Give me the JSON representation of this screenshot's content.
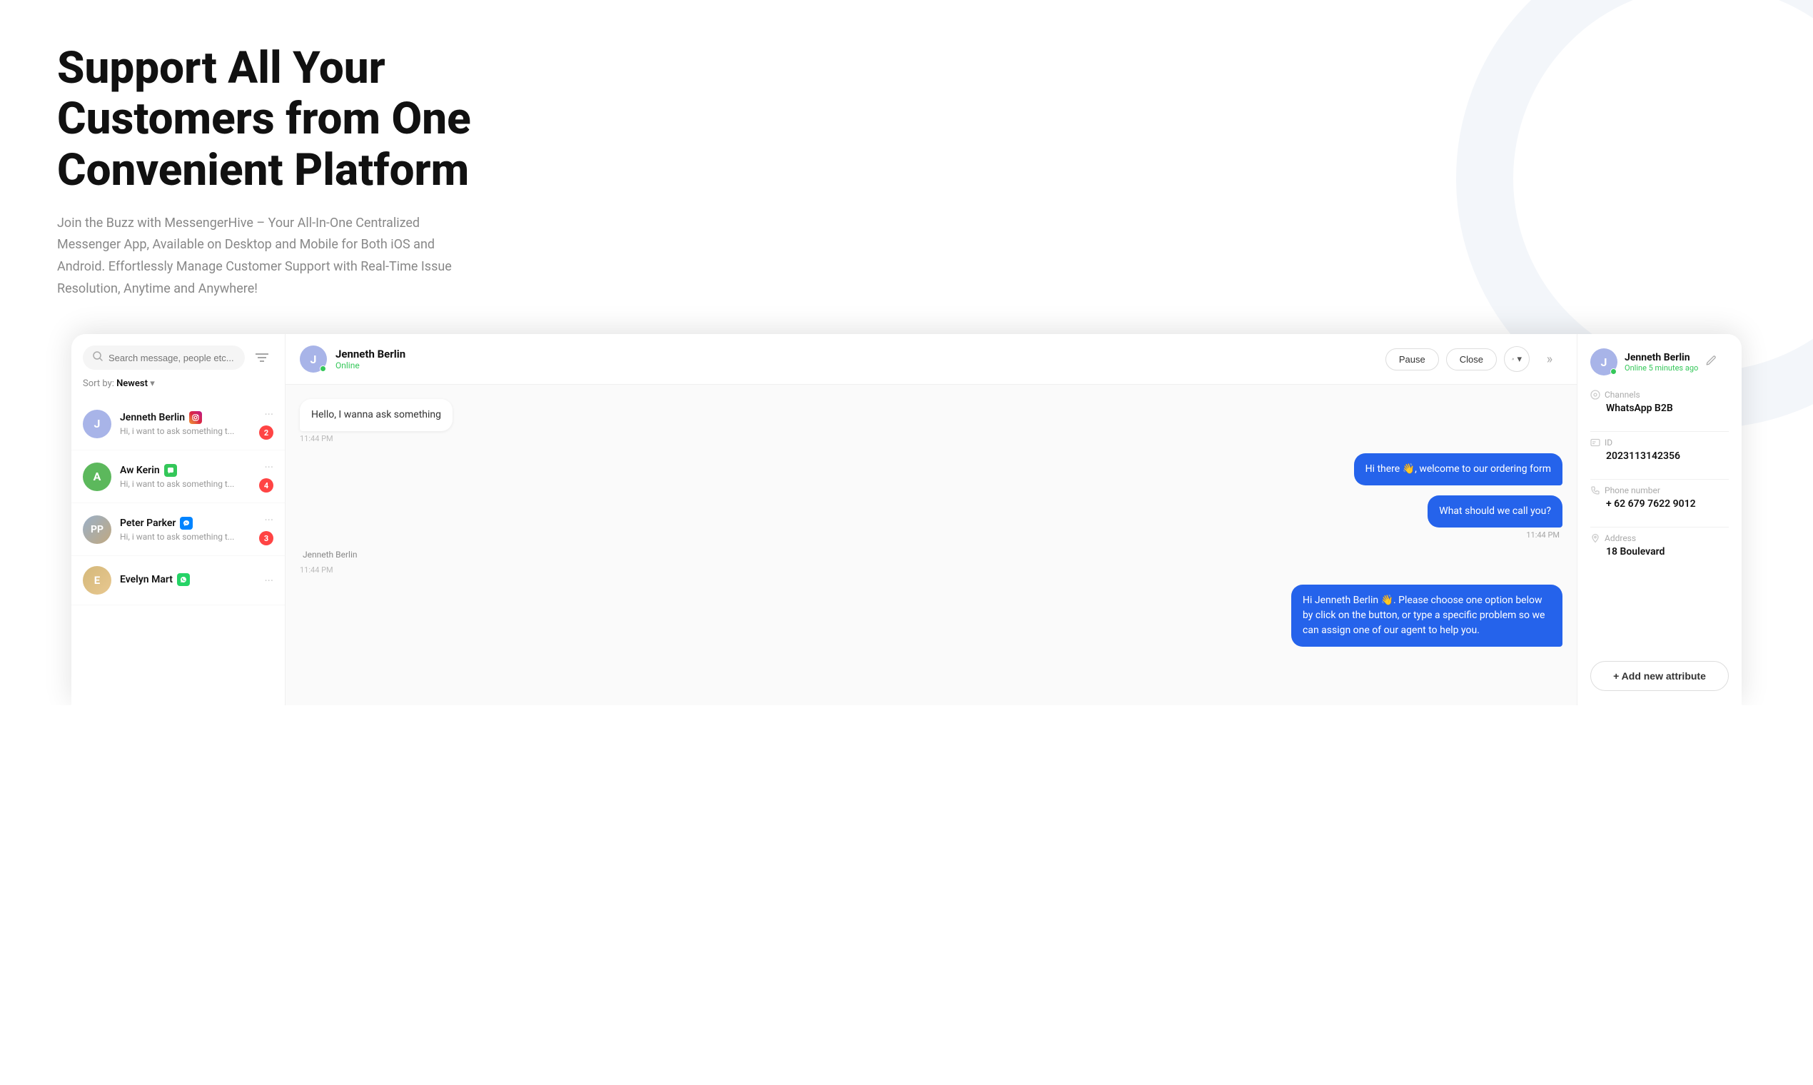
{
  "hero": {
    "title": "Support All Your Customers from One Convenient Platform",
    "subtitle": "Join the Buzz with MessengerHive – Your All-In-One Centralized Messenger App, Available on Desktop and Mobile for Both iOS and Android. Effortlessly Manage Customer Support with Real-Time Issue Resolution, Anytime and Anywhere!"
  },
  "search": {
    "placeholder": "Search message, people etc..."
  },
  "sort": {
    "label": "Sort by:",
    "value": "Newest"
  },
  "conversations": [
    {
      "id": "conv-1",
      "name": "Jenneth Berlin",
      "channel": "instagram",
      "channel_label": "Instagram",
      "preview": "Hi, i want to ask something t...",
      "badge": "2",
      "avatar_letter": "J",
      "avatar_color": "#a8b4e8"
    },
    {
      "id": "conv-2",
      "name": "Aw Kerin",
      "channel": "messages",
      "channel_label": "Messages",
      "preview": "Hi, i want to ask something t...",
      "badge": "4",
      "avatar_letter": "A",
      "avatar_color": "#5cb85c"
    },
    {
      "id": "conv-3",
      "name": "Peter Parker",
      "channel": "messenger",
      "channel_label": "Messenger",
      "preview": "Hi, i want to ask something t...",
      "badge": "3",
      "avatar_letter": "PP",
      "avatar_color": "#8ba8c8"
    },
    {
      "id": "conv-4",
      "name": "Evelyn Mart",
      "channel": "whatsapp",
      "channel_label": "WhatsApp",
      "preview": "",
      "badge": "",
      "avatar_letter": "E",
      "avatar_color": "#d4b87a"
    }
  ],
  "chat": {
    "contact_name": "Jenneth Berlin",
    "contact_status": "Online",
    "buttons": {
      "pause": "Pause",
      "close": "Close",
      "person": "▼"
    },
    "messages": [
      {
        "id": "msg-1",
        "type": "incoming",
        "sender": "",
        "text": "Hello, I wanna ask something",
        "time": "11:44 PM"
      },
      {
        "id": "msg-2",
        "type": "outgoing",
        "sender": "",
        "text": "Hi there 👋, welcome to our ordering form",
        "time": ""
      },
      {
        "id": "msg-3",
        "type": "outgoing",
        "sender": "",
        "text": "What should we call you?",
        "time": "11:44 PM"
      },
      {
        "id": "msg-4",
        "type": "incoming",
        "sender": "Jenneth Berlin",
        "text": "",
        "time": "11:44 PM"
      },
      {
        "id": "msg-5",
        "type": "outgoing",
        "sender": "",
        "text": "Hi Jenneth Berlin 👋. Please choose one option below by click on the button, or type a specific problem so we can assign one of our agent to help you.",
        "time": ""
      }
    ]
  },
  "right_panel": {
    "contact_name": "Jenneth Berlin",
    "contact_status": "Online 5 minutes ago",
    "sections": [
      {
        "id": "channels",
        "label": "Channels",
        "value": "WhatsApp B2B",
        "icon": "gear"
      },
      {
        "id": "id",
        "label": "ID",
        "value": "2023113142356",
        "icon": "gear"
      },
      {
        "id": "phone",
        "label": "Phone number",
        "value": "+ 62 679 7622 9012",
        "icon": "phone"
      },
      {
        "id": "address",
        "label": "Address",
        "value": "18 Boulevard",
        "icon": "location"
      }
    ],
    "add_attribute_label": "+ Add new attribute"
  }
}
